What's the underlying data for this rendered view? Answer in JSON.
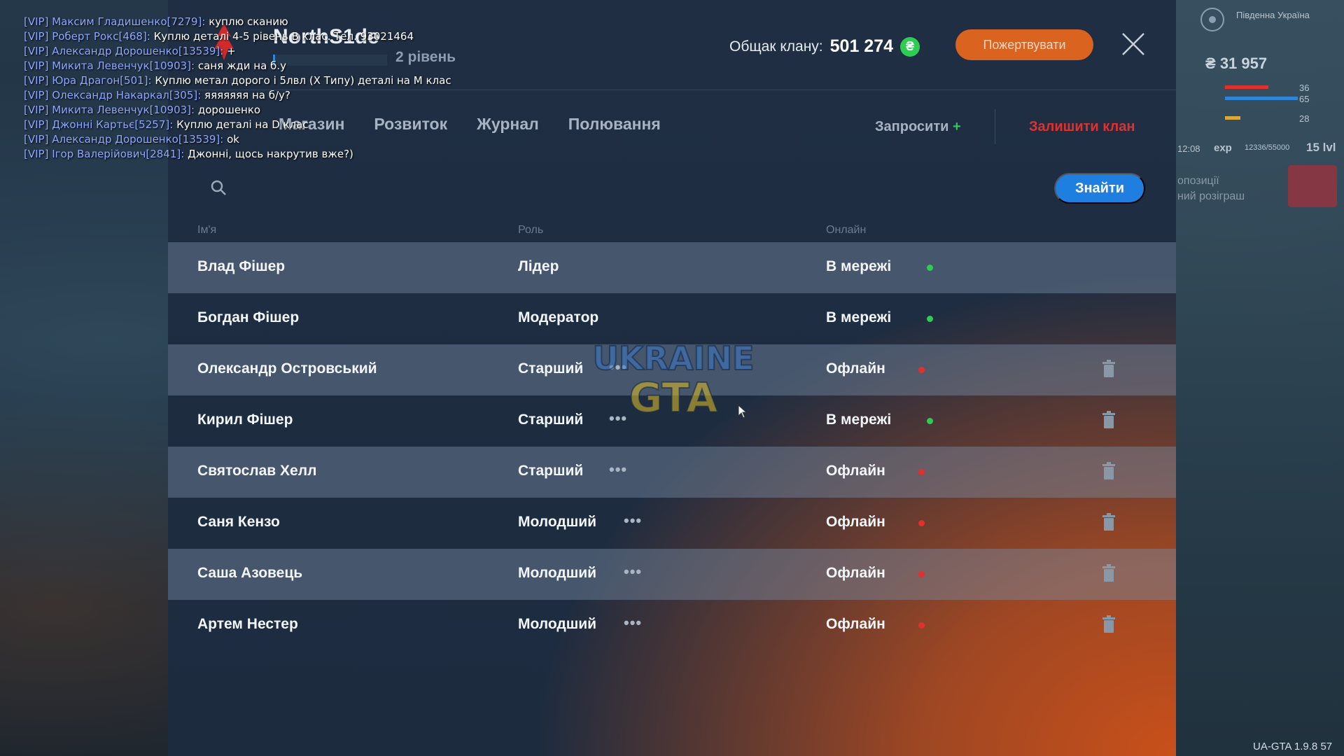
{
  "header": {
    "clan_name": "NorthS1de",
    "level_text": "2 рівень",
    "treasury_label": "Общак клану:",
    "treasury_value": "501 274",
    "currency_symbol": "₴",
    "donate_label": "Пожертвувати"
  },
  "tabs": [
    {
      "label": "Магазин"
    },
    {
      "label": "Розвиток"
    },
    {
      "label": "Журнал"
    },
    {
      "label": "Полювання"
    }
  ],
  "actions": {
    "invite_label": "Запросити",
    "invite_plus": "+",
    "leave_label": "Залишити клан",
    "find_label": "Знайти"
  },
  "columns": {
    "name": "Ім'я",
    "role": "Роль",
    "online": "Онлайн"
  },
  "members": [
    {
      "name": "Влад Фішер",
      "role": "Лідер",
      "status": "В мережі",
      "online": true,
      "editable": false
    },
    {
      "name": "Богдан Фішер",
      "role": "Модератор",
      "status": "В мережі",
      "online": true,
      "editable": false
    },
    {
      "name": "Олександр Островський",
      "role": "Старший",
      "status": "Офлайн",
      "online": false,
      "editable": true
    },
    {
      "name": "Кирил Фішер",
      "role": "Старший",
      "status": "В мережі",
      "online": true,
      "editable": true
    },
    {
      "name": "Святослав Хелл",
      "role": "Старший",
      "status": "Офлайн",
      "online": false,
      "editable": true
    },
    {
      "name": "Саня Кензо",
      "role": "Молодший",
      "status": "Офлайн",
      "online": false,
      "editable": true
    },
    {
      "name": "Саша Азовець",
      "role": "Молодший",
      "status": "Офлайн",
      "online": false,
      "editable": true
    },
    {
      "name": "Артем Нестер",
      "role": "Молодший",
      "status": "Офлайн",
      "online": false,
      "editable": true
    }
  ],
  "more_glyph": "•••",
  "colors": {
    "online": "#2ecc52",
    "offline": "#e0312f",
    "accent": "#1e7fe0",
    "donate": "#d9631f"
  },
  "chat": [
    {
      "name": "[VIP] Максим Гладишенко[7279]:",
      "msg": "куплю сканию"
    },
    {
      "name": "[VIP] Роберт Рокс[468]:",
      "msg": "Куплю деталі 4-5 рівень В клас. Тел. 93021464"
    },
    {
      "name": "[VIP] Александр Дорошенко[13539]:",
      "msg": "+"
    },
    {
      "name": "[VIP] Микита Левенчук[10903]:",
      "msg": "саня жди на б.у"
    },
    {
      "name": "[VIP] Юра Драгон[501]:",
      "msg": "Куплю метал дорого і 5лвл (X Типу) деталі на М клас"
    },
    {
      "name": "[VIP] Олександр Накаркал[305]:",
      "msg": "яяяяяяя на б/у?"
    },
    {
      "name": "[VIP] Микита Левенчук[10903]:",
      "msg": "дорошенко"
    },
    {
      "name": "[VIP] Джонні Картьє[5257]:",
      "msg": "Куплю деталі на D клас"
    },
    {
      "name": "[VIP] Александр Дорошенко[13539]:",
      "msg": "ok"
    },
    {
      "name": "[VIP] Ігор Валерійович[2841]:",
      "msg": "Джонні, щось накрутив вже?)"
    }
  ],
  "hud": {
    "money": "31 957",
    "money_symbol": "₴",
    "region": "Південна Україна",
    "time": "12:08",
    "exp_label": "exp",
    "exp_value": "12336/55000",
    "level": "15 lvl",
    "stat1": "36",
    "stat2": "65",
    "stat3": "28",
    "promo_line1": "опозиції",
    "promo_line2": "ний розіграш"
  },
  "watermark": {
    "line1": "UKRAINE",
    "line2": "GTA"
  },
  "version": "UA-GTA 1.9.8",
  "version_suffix": "57"
}
